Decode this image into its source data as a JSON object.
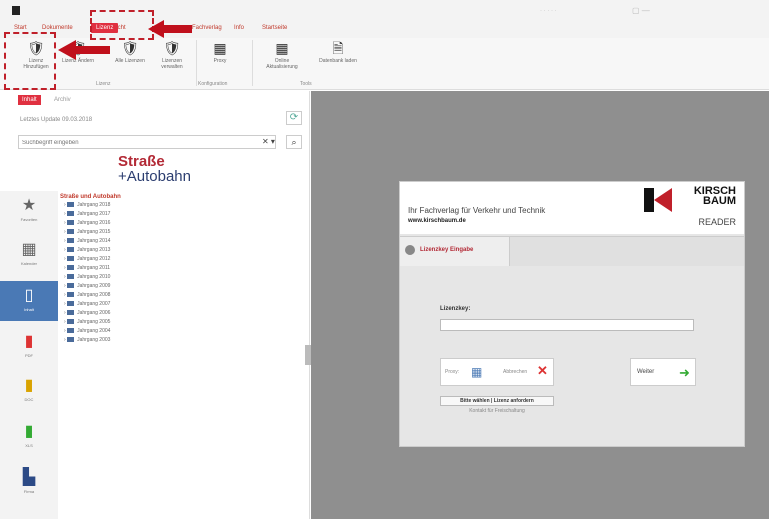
{
  "colors": {
    "accent": "#e03040",
    "brand_blue": "#4a79b5",
    "panel_gray": "#8f8f8f"
  },
  "menu": {
    "items": [
      {
        "label": "Start"
      },
      {
        "label": "Dokumente"
      },
      {
        "label": "Ansicht"
      },
      {
        "label": "Lizenz"
      },
      {
        "label": "Fachverlag"
      },
      {
        "label": "Info"
      },
      {
        "label": "Startseite"
      }
    ],
    "active_index": 3
  },
  "ribbon": {
    "buttons": [
      {
        "label": "Lizenz Hinzufügen",
        "icon": "shield-check-icon"
      },
      {
        "label": "Lizenz Ändern",
        "icon": "shield-icon"
      },
      {
        "label": "Alle Lizenzen",
        "icon": "shield-check-icon"
      },
      {
        "label": "Lizenzen verwalten",
        "icon": "shield-outline-icon"
      },
      {
        "label": "Proxy",
        "icon": "proxy-icon"
      },
      {
        "label": "Online Aktualisierung",
        "icon": "update-icon"
      },
      {
        "label": "Datenbank laden",
        "icon": "document-icon"
      }
    ],
    "groups": [
      {
        "label": "Lizenz"
      },
      {
        "label": "Konfiguration"
      },
      {
        "label": "Tools"
      }
    ]
  },
  "left": {
    "tabs": [
      {
        "label": "Inhalt"
      },
      {
        "label": "Archiv"
      }
    ],
    "update_text": "Letztes Update 09.03.2018",
    "search_placeholder": "Suchbegriff eingeben",
    "logo_line1": "Straße",
    "logo_line2": "+Autobahn",
    "nav": [
      {
        "label": "Favoriten",
        "icon": "star-icon"
      },
      {
        "label": "Kalender",
        "icon": "calendar-icon"
      },
      {
        "label": "Inhalt",
        "icon": "document-icon"
      },
      {
        "label": "PDF",
        "icon": "pdf-icon"
      },
      {
        "label": "DOC",
        "icon": "doc-icon"
      },
      {
        "label": "XLS",
        "icon": "xls-icon"
      },
      {
        "label": "Firma",
        "icon": "building-icon"
      }
    ],
    "tree": {
      "root": "Straße und Autobahn",
      "items": [
        "Jahrgang 2018",
        "Jahrgang 2017",
        "Jahrgang 2016",
        "Jahrgang 2015",
        "Jahrgang 2014",
        "Jahrgang 2013",
        "Jahrgang 2012",
        "Jahrgang 2011",
        "Jahrgang 2010",
        "Jahrgang 2009",
        "Jahrgang 2008",
        "Jahrgang 2007",
        "Jahrgang 2006",
        "Jahrgang 2005",
        "Jahrgang 2004",
        "Jahrgang 2003"
      ]
    }
  },
  "card": {
    "tagline": "Ihr Fachverlag für Verkehr und Technik",
    "url": "www.kirschbaum.de",
    "brand_line1": "KIRSCH",
    "brand_line2": "BAUM",
    "brand_line3": "READER",
    "tab_label": "Lizenzkey Eingabe",
    "license_label": "Lizenzkey:",
    "license_value": "",
    "proxy_label": "Proxy:",
    "abbrechen_label": "Abbrechen",
    "weiter_label": "Weiter",
    "link1": "Bitte wählen | Lizenz anfordern",
    "link2": "Kontakt für Freischaltung"
  }
}
